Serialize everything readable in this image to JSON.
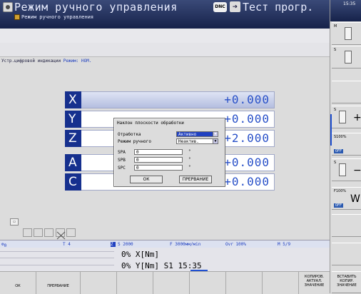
{
  "header": {
    "mode_title": "Режим ручного управления",
    "mode_subtitle": "Режим ручного управления",
    "dnc": "DNC",
    "program_mode": "Тест прогр."
  },
  "status_line": {
    "prefix": "Устр.цифровой индикации",
    "hl": "Режим: НОМ."
  },
  "axes": [
    {
      "label": "X",
      "value": "+0.000"
    },
    {
      "label": "Y",
      "value": "+0.000"
    },
    {
      "label": "Z",
      "value": "+2.000"
    },
    {
      "label": "A",
      "value": "+0.000"
    },
    {
      "label": "C",
      "value": "+0.000"
    }
  ],
  "dialog": {
    "title": "Наклон плоскости обработки",
    "work_label": "Отработка",
    "work_value": "Активно",
    "manual_label": "Режим ручного",
    "manual_value": "Неактив.",
    "spa_label": "SPA",
    "spa_value": "0",
    "spb_label": "SPB",
    "spb_value": "0",
    "spc_label": "SPC",
    "spc_value": "0",
    "deg": "°",
    "ok": "ОК",
    "cancel": "ПРЕРВАНИЕ"
  },
  "status_bar": {
    "tool": "0",
    "t": "T 4",
    "s": "S 2000",
    "f": "F 3000мм/мin",
    "ovr": "Ovr 100%",
    "m": "M 5/9"
  },
  "load": {
    "x": "0% X[Nm]",
    "y": "0% Y[Nm]  S1   15:35"
  },
  "softkeys": {
    "ok": "ОК",
    "cancel": "ПРЕРВАНИЕ",
    "copy_actual": "КОПИРОВ. АКТУАЛ. ЗНАЧЕНИЕ",
    "paste_copied": "ВСТАВИТЬ КОПИР. ЗНАЧЕНИЕ"
  },
  "vkeys": {
    "clock": "15:35",
    "m": "M",
    "s": "S",
    "s_plus": "S",
    "s100": "S100%",
    "off1": "OFF",
    "s_minus": "S",
    "f100": "F100%",
    "off2": "OFF"
  }
}
